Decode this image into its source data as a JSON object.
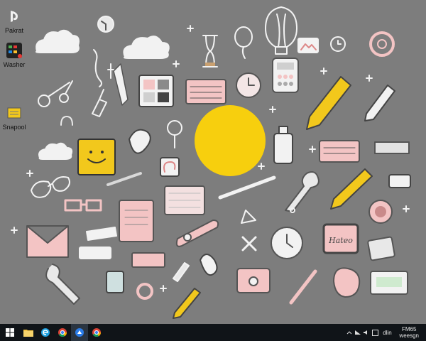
{
  "desktop": {
    "icons": [
      {
        "label": "Pakrat",
        "icon": "playstation-icon"
      },
      {
        "label": "Washer",
        "icon": "app-tile-icon"
      },
      {
        "label": "Snapool",
        "icon": "notes-stack-icon"
      }
    ]
  },
  "wallpaper": {
    "background_color": "#7d7d7d",
    "sun_color": "#f7cf0e",
    "accent_pink": "#f3c4c4",
    "accent_yellow": "#f2c81c",
    "sticker_text": "Hateo"
  },
  "taskbar": {
    "apps": [
      {
        "name": "start-button",
        "icon": "windows-icon"
      },
      {
        "name": "file-explorer",
        "icon": "folder-icon"
      },
      {
        "name": "edge-browser",
        "icon": "edge-icon"
      },
      {
        "name": "chrome-browser",
        "icon": "chrome-icon"
      },
      {
        "name": "store-app",
        "icon": "store-icon"
      },
      {
        "name": "chrome-browser-2",
        "icon": "chrome-icon"
      }
    ],
    "tray": {
      "clock_time": "FM65",
      "clock_date": "weesgn",
      "ime_label": "dlin"
    }
  }
}
